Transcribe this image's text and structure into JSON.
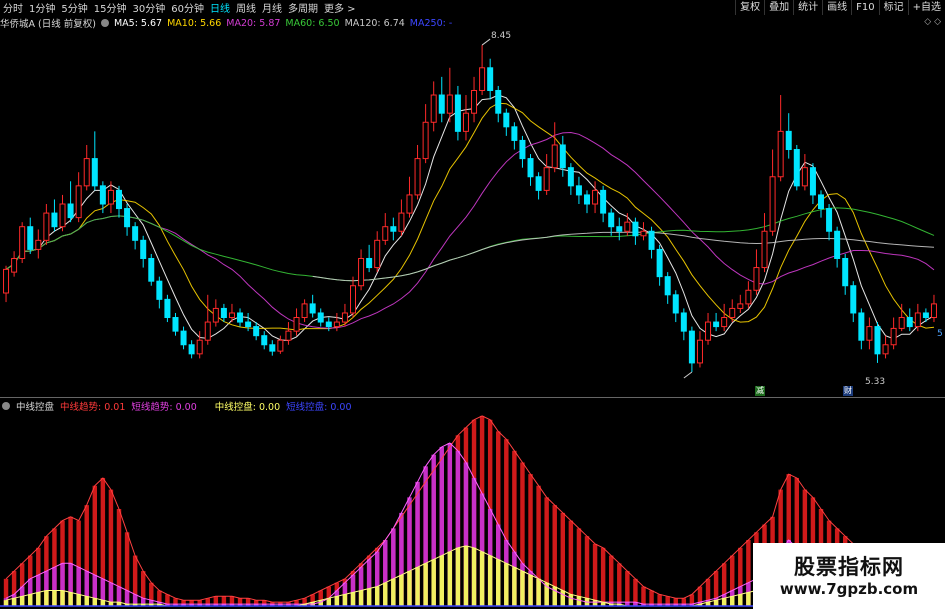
{
  "toolbar": {
    "periods": [
      "分时",
      "1分钟",
      "5分钟",
      "15分钟",
      "30分钟",
      "60分钟",
      "日线",
      "周线",
      "月线",
      "多周期",
      "更多 >"
    ],
    "active_index": 6,
    "right_buttons": [
      "复权",
      "叠加",
      "统计",
      "画线",
      "F10",
      "标记",
      "+自选"
    ]
  },
  "main_legend": {
    "title": "华侨城A (日线 前复权)",
    "ma5": "MA5: 5.67",
    "ma10": "MA10: 5.66",
    "ma20": "MA20: 5.87",
    "ma60": "MA60: 6.50",
    "ma120": "MA120: 6.74",
    "ma250": "MA250: -"
  },
  "colors": {
    "ma5": "#ffffff",
    "ma10": "#ffd700",
    "ma20": "#d33cd3",
    "ma60": "#38c838",
    "ma120": "#c8c8c8",
    "ma250": "#3c46ff",
    "up": "#ff2a2a",
    "down": "#00e5ff"
  },
  "annotations": {
    "high_label": "8.45",
    "low_label": "5.33",
    "tag_a": "减",
    "tag_b": "财",
    "right_edge": "5"
  },
  "sub_legend": {
    "name": "中线控盘",
    "trend_mid": "中线趋势: 0.01",
    "trend_short": "短线趋势: 0.00",
    "control": "中线控盘: 0.00",
    "extra": "短线控盘: 0.00"
  },
  "watermark": {
    "line1": "股票指标网",
    "line2": "www.7gpzb.com"
  },
  "chart_data": {
    "type": "candlestick",
    "candles": [
      [
        5.72,
        5.98,
        6.02,
        5.62
      ],
      [
        5.95,
        6.1,
        6.18,
        5.9
      ],
      [
        6.1,
        6.45,
        6.5,
        6.05
      ],
      [
        6.45,
        6.2,
        6.55,
        6.15
      ],
      [
        6.2,
        6.3,
        6.42,
        6.1
      ],
      [
        6.3,
        6.6,
        6.7,
        6.25
      ],
      [
        6.6,
        6.45,
        6.75,
        6.4
      ],
      [
        6.45,
        6.7,
        6.8,
        6.4
      ],
      [
        6.7,
        6.55,
        6.95,
        6.5
      ],
      [
        6.55,
        6.9,
        7.05,
        6.5
      ],
      [
        6.9,
        7.2,
        7.35,
        6.85
      ],
      [
        7.2,
        6.9,
        7.5,
        6.85
      ],
      [
        6.9,
        6.7,
        6.95,
        6.6
      ],
      [
        6.7,
        6.85,
        6.95,
        6.6
      ],
      [
        6.85,
        6.65,
        6.9,
        6.55
      ],
      [
        6.65,
        6.45,
        6.7,
        6.35
      ],
      [
        6.45,
        6.3,
        6.5,
        6.2
      ],
      [
        6.3,
        6.1,
        6.35,
        6.0
      ],
      [
        6.1,
        5.85,
        6.15,
        5.8
      ],
      [
        5.85,
        5.65,
        5.9,
        5.55
      ],
      [
        5.65,
        5.45,
        5.7,
        5.4
      ],
      [
        5.45,
        5.3,
        5.5,
        5.25
      ],
      [
        5.3,
        5.15,
        5.35,
        5.1
      ],
      [
        5.15,
        5.05,
        5.2,
        5.0
      ],
      [
        5.05,
        5.2,
        5.3,
        5.0
      ],
      [
        5.2,
        5.4,
        5.7,
        5.15
      ],
      [
        5.4,
        5.55,
        5.65,
        5.35
      ],
      [
        5.55,
        5.45,
        5.6,
        5.4
      ],
      [
        5.45,
        5.5,
        5.6,
        5.4
      ],
      [
        5.5,
        5.4,
        5.55,
        5.35
      ],
      [
        5.4,
        5.35,
        5.5,
        5.3
      ],
      [
        5.35,
        5.25,
        5.4,
        5.2
      ],
      [
        5.25,
        5.15,
        5.3,
        5.1
      ],
      [
        5.15,
        5.08,
        5.2,
        5.03
      ],
      [
        5.08,
        5.2,
        5.25,
        5.05
      ],
      [
        5.2,
        5.3,
        5.4,
        5.15
      ],
      [
        5.3,
        5.45,
        5.55,
        5.25
      ],
      [
        5.45,
        5.6,
        5.65,
        5.4
      ],
      [
        5.6,
        5.5,
        5.7,
        5.45
      ],
      [
        5.5,
        5.4,
        5.55,
        5.35
      ],
      [
        5.4,
        5.35,
        5.45,
        5.3
      ],
      [
        5.35,
        5.4,
        5.5,
        5.3
      ],
      [
        5.4,
        5.5,
        5.6,
        5.35
      ],
      [
        5.5,
        5.8,
        5.9,
        5.45
      ],
      [
        5.8,
        6.1,
        6.2,
        5.75
      ],
      [
        6.1,
        6.0,
        6.25,
        5.95
      ],
      [
        6.0,
        6.3,
        6.4,
        5.95
      ],
      [
        6.3,
        6.45,
        6.6,
        6.25
      ],
      [
        6.45,
        6.4,
        6.55,
        6.3
      ],
      [
        6.4,
        6.6,
        6.75,
        6.35
      ],
      [
        6.6,
        6.8,
        7.0,
        6.55
      ],
      [
        6.8,
        7.2,
        7.35,
        6.75
      ],
      [
        7.2,
        7.6,
        7.8,
        7.15
      ],
      [
        7.6,
        7.9,
        8.05,
        7.5
      ],
      [
        7.9,
        7.7,
        8.1,
        7.6
      ],
      [
        7.7,
        7.9,
        8.2,
        7.6
      ],
      [
        7.9,
        7.5,
        8.0,
        7.4
      ],
      [
        7.5,
        7.7,
        7.9,
        7.4
      ],
      [
        7.7,
        7.95,
        8.1,
        7.6
      ],
      [
        7.95,
        8.2,
        8.45,
        7.9
      ],
      [
        8.2,
        7.95,
        8.3,
        7.85
      ],
      [
        7.95,
        7.7,
        8.0,
        7.6
      ],
      [
        7.7,
        7.55,
        7.75,
        7.45
      ],
      [
        7.55,
        7.4,
        7.6,
        7.3
      ],
      [
        7.4,
        7.2,
        7.45,
        7.1
      ],
      [
        7.2,
        7.0,
        7.25,
        6.9
      ],
      [
        7.0,
        6.85,
        7.05,
        6.75
      ],
      [
        6.85,
        7.1,
        7.25,
        6.8
      ],
      [
        7.1,
        7.35,
        7.6,
        7.05
      ],
      [
        7.35,
        7.1,
        7.45,
        7.0
      ],
      [
        7.1,
        6.9,
        7.15,
        6.8
      ],
      [
        6.9,
        6.8,
        7.0,
        6.7
      ],
      [
        6.8,
        6.7,
        6.85,
        6.6
      ],
      [
        6.7,
        6.85,
        6.95,
        6.6
      ],
      [
        6.85,
        6.6,
        6.9,
        6.5
      ],
      [
        6.6,
        6.45,
        6.65,
        6.35
      ],
      [
        6.45,
        6.4,
        6.55,
        6.3
      ],
      [
        6.4,
        6.5,
        6.6,
        6.35
      ],
      [
        6.5,
        6.35,
        6.55,
        6.25
      ],
      [
        6.35,
        6.4,
        6.5,
        6.3
      ],
      [
        6.4,
        6.2,
        6.45,
        6.1
      ],
      [
        6.2,
        5.9,
        6.25,
        5.8
      ],
      [
        5.9,
        5.7,
        5.95,
        5.6
      ],
      [
        5.7,
        5.5,
        5.75,
        5.4
      ],
      [
        5.5,
        5.3,
        5.55,
        5.2
      ],
      [
        5.3,
        4.95,
        5.35,
        4.85
      ],
      [
        4.95,
        5.2,
        5.3,
        4.9
      ],
      [
        5.2,
        5.4,
        5.5,
        5.15
      ],
      [
        5.4,
        5.35,
        5.5,
        5.3
      ],
      [
        5.35,
        5.45,
        5.6,
        5.3
      ],
      [
        5.45,
        5.55,
        5.65,
        5.4
      ],
      [
        5.55,
        5.6,
        5.7,
        5.5
      ],
      [
        5.6,
        5.75,
        5.85,
        5.55
      ],
      [
        5.75,
        6.0,
        6.2,
        5.7
      ],
      [
        6.0,
        6.4,
        6.6,
        5.95
      ],
      [
        6.4,
        7.0,
        7.3,
        6.35
      ],
      [
        7.0,
        7.5,
        7.9,
        6.95
      ],
      [
        7.5,
        7.3,
        7.7,
        7.2
      ],
      [
        7.3,
        6.9,
        7.35,
        6.85
      ],
      [
        6.9,
        7.1,
        7.25,
        6.85
      ],
      [
        7.1,
        6.8,
        7.15,
        6.7
      ],
      [
        6.8,
        6.65,
        6.85,
        6.55
      ],
      [
        6.65,
        6.4,
        6.7,
        6.3
      ],
      [
        6.4,
        6.1,
        6.45,
        6.0
      ],
      [
        6.1,
        5.8,
        6.15,
        5.7
      ],
      [
        5.8,
        5.5,
        5.85,
        5.4
      ],
      [
        5.5,
        5.2,
        5.55,
        5.1
      ],
      [
        5.2,
        5.35,
        5.45,
        5.1
      ],
      [
        5.35,
        5.05,
        5.4,
        4.95
      ],
      [
        5.05,
        5.15,
        5.25,
        5.0
      ],
      [
        5.15,
        5.33,
        5.45,
        5.1
      ],
      [
        5.33,
        5.45,
        5.6,
        5.3
      ],
      [
        5.45,
        5.35,
        5.55,
        5.3
      ],
      [
        5.35,
        5.5,
        5.6,
        5.3
      ],
      [
        5.5,
        5.45,
        5.55,
        5.4
      ],
      [
        5.45,
        5.6,
        5.7,
        5.4
      ]
    ],
    "indicator": {
      "mid_trend": [
        14,
        18,
        22,
        26,
        30,
        36,
        40,
        44,
        46,
        44,
        52,
        62,
        66,
        60,
        50,
        38,
        26,
        18,
        12,
        8,
        6,
        4,
        3,
        3,
        3,
        4,
        5,
        5,
        5,
        4,
        4,
        3,
        3,
        2,
        2,
        2,
        3,
        4,
        6,
        8,
        10,
        12,
        14,
        18,
        22,
        26,
        30,
        34,
        40,
        46,
        52,
        58,
        64,
        70,
        76,
        82,
        88,
        92,
        96,
        98,
        96,
        90,
        86,
        80,
        74,
        68,
        62,
        56,
        52,
        48,
        44,
        40,
        36,
        32,
        30,
        26,
        22,
        18,
        14,
        10,
        8,
        6,
        5,
        4,
        4,
        6,
        10,
        14,
        18,
        22,
        26,
        30,
        34,
        38,
        42,
        46,
        60,
        68,
        66,
        60,
        56,
        50,
        44,
        40,
        36,
        32,
        28,
        24,
        20,
        16,
        12,
        10,
        8,
        6,
        5,
        4,
        3,
        3,
        3,
        3,
        3
      ],
      "short_trend": [
        4,
        6,
        10,
        14,
        16,
        18,
        20,
        22,
        22,
        20,
        18,
        16,
        14,
        12,
        10,
        8,
        6,
        4,
        3,
        2,
        1,
        1,
        1,
        1,
        1,
        1,
        1,
        1,
        1,
        1,
        1,
        1,
        1,
        1,
        1,
        1,
        1,
        1,
        1,
        2,
        4,
        8,
        12,
        16,
        20,
        24,
        28,
        34,
        40,
        48,
        56,
        64,
        72,
        78,
        82,
        84,
        80,
        74,
        66,
        58,
        50,
        42,
        34,
        28,
        22,
        18,
        14,
        10,
        8,
        6,
        4,
        3,
        2,
        2,
        2,
        2,
        2,
        2,
        2,
        1,
        1,
        1,
        1,
        1,
        1,
        1,
        2,
        3,
        4,
        6,
        8,
        10,
        12,
        14,
        16,
        20,
        28,
        34,
        30,
        22,
        14,
        10,
        8,
        6,
        4,
        3,
        2,
        1,
        1,
        1,
        1,
        1,
        1,
        1,
        1,
        1,
        1,
        1,
        1,
        1,
        1
      ],
      "control": [
        3,
        4,
        5,
        6,
        7,
        8,
        8,
        8,
        7,
        6,
        5,
        4,
        3,
        2,
        2,
        1,
        1,
        1,
        1,
        1,
        0,
        0,
        0,
        0,
        0,
        0,
        0,
        0,
        0,
        0,
        0,
        0,
        0,
        0,
        0,
        0,
        0,
        1,
        2,
        3,
        4,
        5,
        6,
        7,
        8,
        9,
        10,
        12,
        14,
        16,
        18,
        20,
        22,
        24,
        26,
        28,
        30,
        31,
        30,
        28,
        26,
        24,
        22,
        20,
        18,
        16,
        14,
        12,
        10,
        8,
        6,
        5,
        4,
        3,
        2,
        1,
        1,
        0,
        0,
        0,
        0,
        0,
        0,
        0,
        0,
        0,
        1,
        2,
        3,
        4,
        5,
        6,
        7,
        8,
        9,
        10,
        12,
        12,
        11,
        10,
        9,
        8,
        7,
        6,
        5,
        4,
        3,
        2,
        1,
        0,
        0,
        0,
        0,
        0,
        0,
        0,
        0,
        0,
        0,
        0,
        0
      ]
    }
  }
}
